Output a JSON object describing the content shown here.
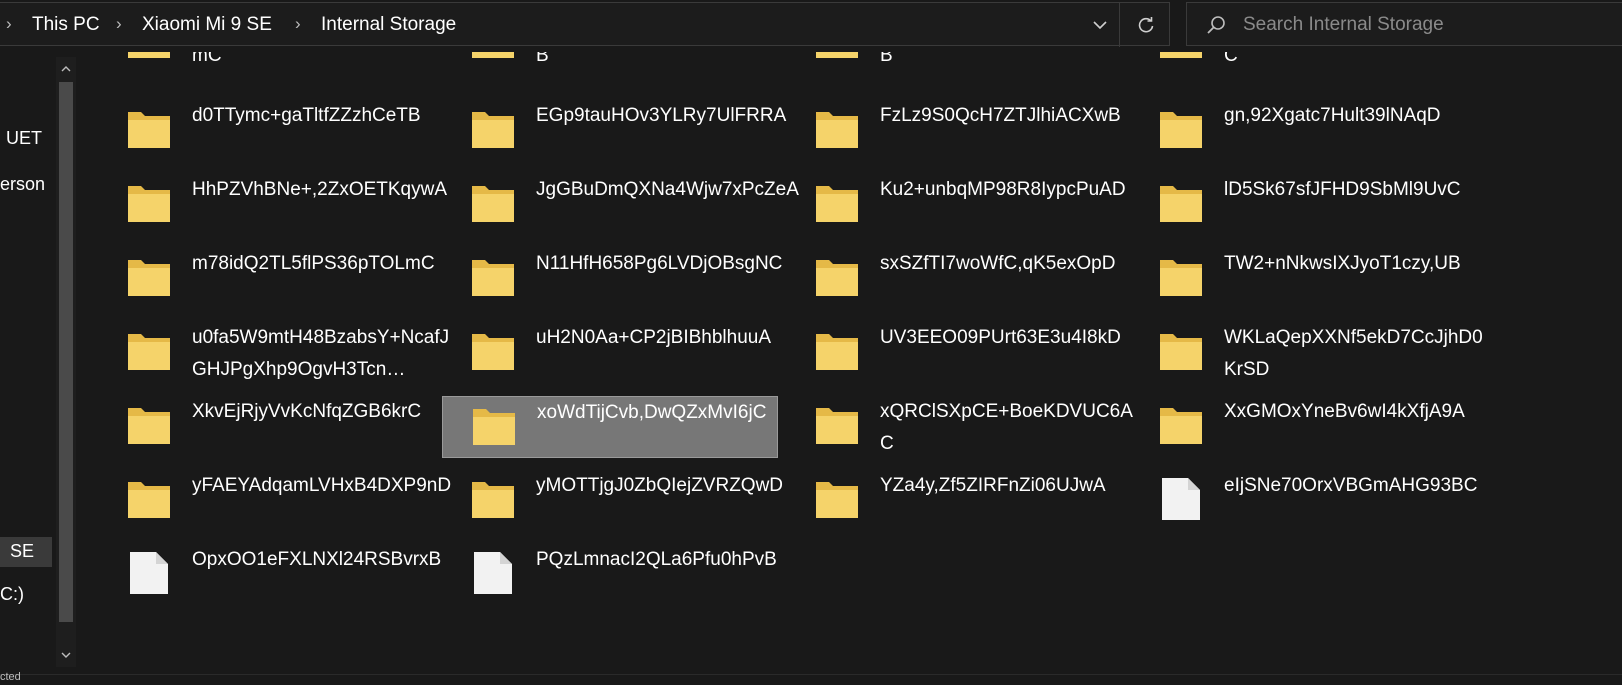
{
  "address_bar": {
    "crumbs": [
      "This PC",
      "Xiaomi Mi 9 SE",
      "Internal Storage"
    ]
  },
  "search": {
    "placeholder": "Search Internal Storage"
  },
  "nav": {
    "items": [
      "UET",
      "erson",
      "SE",
      "C:)"
    ],
    "selected_index": 2
  },
  "status_bar": {
    "text": "cted"
  },
  "files": [
    {
      "name": "mC",
      "type": "folder"
    },
    {
      "name": "B",
      "type": "folder"
    },
    {
      "name": "B",
      "type": "folder"
    },
    {
      "name": "C",
      "type": "folder"
    },
    {
      "name": "d0TTymc+gaTltfZZzhCeTB",
      "type": "folder"
    },
    {
      "name": "EGp9tauHOv3YLRy7UlFRRA",
      "type": "folder"
    },
    {
      "name": "FzLz9S0QcH7ZTJlhiACXwB",
      "type": "folder"
    },
    {
      "name": "gn,92Xgatc7Hult39lNAqD",
      "type": "folder"
    },
    {
      "name": "HhPZVhBNe+,2ZxOETKqywA",
      "type": "folder"
    },
    {
      "name": "JgGBuDmQXNa4Wjw7xPcZeA",
      "type": "folder"
    },
    {
      "name": "Ku2+unbqMP98R8IypcPuAD",
      "type": "folder"
    },
    {
      "name": "lD5Sk67sfJFHD9SbMl9UvC",
      "type": "folder"
    },
    {
      "name": "m78idQ2TL5flPS36pTOLmC",
      "type": "folder"
    },
    {
      "name": "N11HfH658Pg6LVDjOBsgNC",
      "type": "folder"
    },
    {
      "name": "sxSZfTI7woWfC,qK5exOpD",
      "type": "folder"
    },
    {
      "name": "TW2+nNkwsIXJyoT1czy,UB",
      "type": "folder"
    },
    {
      "name": "u0fa5W9mtH48BzabsY+NcafJGHJPgXhp9OgvH3Tcn…",
      "type": "folder"
    },
    {
      "name": "uH2N0Aa+CP2jBIBhblhuuA",
      "type": "folder"
    },
    {
      "name": "UV3EEO09PUrt63E3u4I8kD",
      "type": "folder"
    },
    {
      "name": "WKLaQepXXNf5ekD7CcJjhD0KrSD",
      "type": "folder"
    },
    {
      "name": "XkvEjRjyVvKcNfqZGB6krC",
      "type": "folder"
    },
    {
      "name": "xoWdTijCvb,DwQZxMvI6jC",
      "type": "folder",
      "selected": true
    },
    {
      "name": "xQRClSXpCE+BoeKDVUC6AC",
      "type": "folder"
    },
    {
      "name": "XxGMOxYneBv6wI4kXfjA9A",
      "type": "folder"
    },
    {
      "name": "yFAEYAdqamLVHxB4DXP9nD",
      "type": "folder"
    },
    {
      "name": "yMOTTjgJ0ZbQIejZVRZQwD",
      "type": "folder"
    },
    {
      "name": "YZa4y,Zf5ZIRFnZi06UJwA",
      "type": "folder"
    },
    {
      "name": "eIjSNe70OrxVBGmAHG93BC",
      "type": "file"
    },
    {
      "name": "OpxOO1eFXLNXl24RSBvrxB",
      "type": "file"
    },
    {
      "name": "PQzLmnacI2QLa6Pfu0hPvB",
      "type": "file"
    }
  ],
  "colors": {
    "background": "#191919",
    "folder": "#f5d36a",
    "folder_dark": "#e5b947",
    "selection": "#777777",
    "text": "#ffffff"
  }
}
